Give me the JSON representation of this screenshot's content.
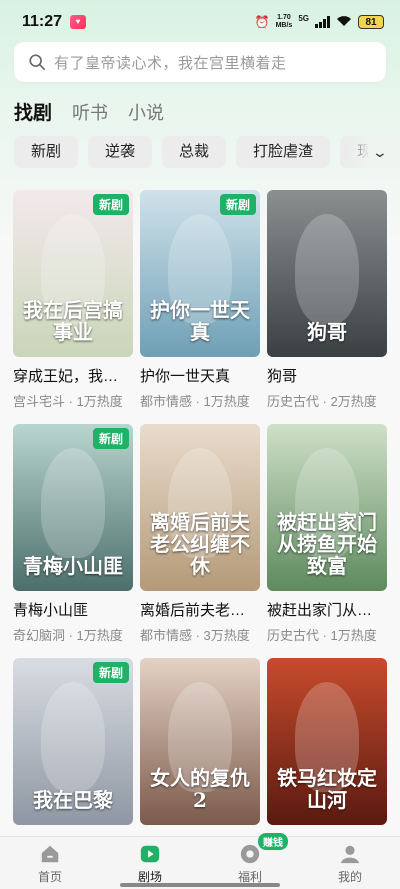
{
  "status_bar": {
    "time": "11:27",
    "net_speed_value": "1.70",
    "net_speed_unit": "MB/s",
    "network": "5G",
    "battery": "81"
  },
  "search": {
    "placeholder": "有了皇帝读心术，我在宫里横着走"
  },
  "tabs": [
    {
      "label": "找剧",
      "active": true
    },
    {
      "label": "听书",
      "active": false
    },
    {
      "label": "小说",
      "active": false
    }
  ],
  "chips": [
    "新剧",
    "逆袭",
    "总裁",
    "打脸虐渣",
    "现代"
  ],
  "new_badge": "新剧",
  "dramas": [
    {
      "title": "穿成王妃，我在后宫搞事业",
      "meta": "宫斗宅斗 · 1万热度",
      "poster_text": "我在后宫搞事业",
      "new": true,
      "colors": [
        "#f3e9ec",
        "#c9d6b8"
      ]
    },
    {
      "title": "护你一世天真",
      "meta": "都市情感 · 1万热度",
      "poster_text": "护你一世天真",
      "new": true,
      "colors": [
        "#cfe2ea",
        "#6f9fb5"
      ]
    },
    {
      "title": "狗哥",
      "meta": "历史古代 · 2万热度",
      "poster_text": "狗哥",
      "new": false,
      "colors": [
        "#8a8f90",
        "#3b4043"
      ]
    },
    {
      "title": "青梅小山匪",
      "meta": "奇幻脑洞 · 1万热度",
      "poster_text": "青梅小山匪",
      "new": true,
      "colors": [
        "#b9d5cf",
        "#4c6f6b"
      ]
    },
    {
      "title": "离婚后前夫老公纠缠不休",
      "meta": "都市情感 · 3万热度",
      "poster_text": "离婚后前夫老公纠缠不休",
      "new": false,
      "colors": [
        "#e9dccd",
        "#b49a78"
      ]
    },
    {
      "title": "被赶出家门从捞鱼开始致富",
      "meta": "历史古代 · 1万热度",
      "poster_text": "被赶出家门从捞鱼开始致富",
      "new": false,
      "colors": [
        "#cfe0c8",
        "#5e8a5e"
      ]
    },
    {
      "title": "",
      "meta": "",
      "poster_text": "我在巴黎",
      "new": true,
      "colors": [
        "#d9dde3",
        "#8e97a3"
      ]
    },
    {
      "title": "",
      "meta": "",
      "poster_text": "女人的复仇2",
      "new": false,
      "colors": [
        "#e4d2c6",
        "#7b5a4a"
      ]
    },
    {
      "title": "",
      "meta": "",
      "poster_text": "铁马红妆定山河",
      "new": false,
      "colors": [
        "#c74b2c",
        "#5a1a10"
      ]
    }
  ],
  "bottom_nav": [
    {
      "label": "首页",
      "icon": "home-icon",
      "active": false
    },
    {
      "label": "剧场",
      "icon": "theater-icon",
      "active": true
    },
    {
      "label": "福利",
      "icon": "welfare-icon",
      "active": false,
      "badge": "赚钱"
    },
    {
      "label": "我的",
      "icon": "profile-icon",
      "active": false
    }
  ],
  "colors": {
    "accent": "#1fb266"
  }
}
